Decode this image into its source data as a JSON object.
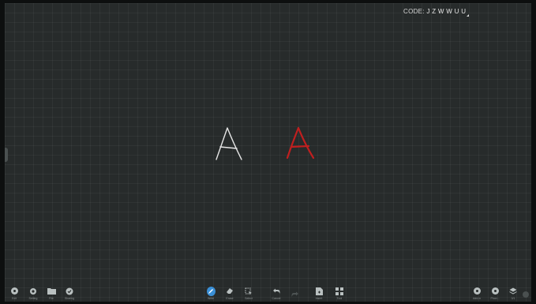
{
  "header": {
    "code_label": "CODE:",
    "code_value": "J Z W W U U"
  },
  "canvas": {
    "letters": [
      "A",
      "A"
    ],
    "stroke_colors": {
      "white": "#e6e6e6",
      "red": "#c01f1f"
    },
    "grid_color": "#2f3434",
    "background": "#272b2b"
  },
  "toolbar": {
    "left": [
      {
        "label": "Exit",
        "icon": "exit-icon"
      },
      {
        "label": "Setting",
        "icon": "gear-icon"
      },
      {
        "label": "File",
        "icon": "folder-icon"
      },
      {
        "label": "Sharing",
        "icon": "share-icon"
      }
    ],
    "center": [
      {
        "label": "Write",
        "icon": "pen-icon",
        "active": true
      },
      {
        "label": "Erase",
        "icon": "eraser-icon"
      },
      {
        "label": "Select",
        "icon": "select-icon"
      },
      {
        "label": "Cancel",
        "icon": "undo-icon"
      },
      {
        "label": "",
        "icon": "redo-icon"
      },
      {
        "label": "Insert",
        "icon": "insert-icon"
      },
      {
        "label": "Tool",
        "icon": "grid-icon"
      }
    ],
    "right": [
      {
        "label": "Add-in",
        "icon": "add-in-icon"
      },
      {
        "label": "Phon...",
        "icon": "phone-icon"
      },
      {
        "label": "0/1",
        "icon": "pages-icon"
      },
      {
        "label": "",
        "icon": "more-icon"
      }
    ],
    "accent": "#3a8fd6"
  }
}
